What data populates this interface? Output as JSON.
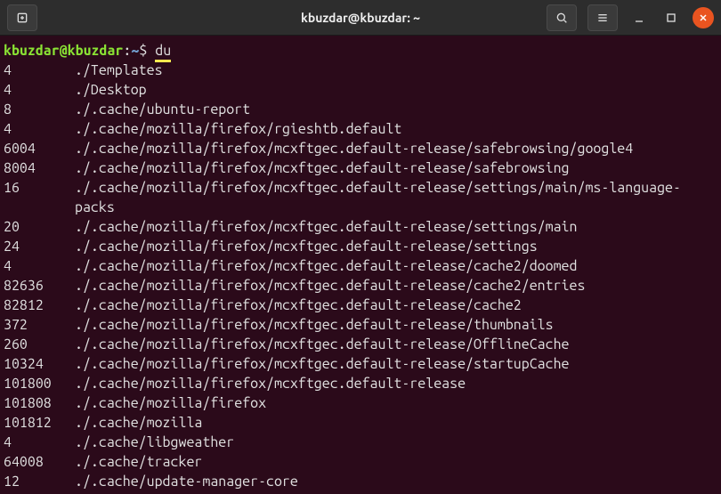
{
  "titlebar": {
    "title": "kbuzdar@kbuzdar: ~"
  },
  "prompt": {
    "user_host": "kbuzdar@kbuzdar",
    "colon": ":",
    "path": "~",
    "dollar": "$ ",
    "command": "du"
  },
  "output": [
    {
      "size": "4",
      "path": "./Templates"
    },
    {
      "size": "4",
      "path": "./Desktop"
    },
    {
      "size": "8",
      "path": "./.cache/ubuntu-report"
    },
    {
      "size": "4",
      "path": "./.cache/mozilla/firefox/rgieshtb.default"
    },
    {
      "size": "6004",
      "path": "./.cache/mozilla/firefox/mcxftgec.default-release/safebrowsing/google4"
    },
    {
      "size": "8004",
      "path": "./.cache/mozilla/firefox/mcxftgec.default-release/safebrowsing"
    },
    {
      "size": "16",
      "path": "./.cache/mozilla/firefox/mcxftgec.default-release/settings/main/ms-language-packs"
    },
    {
      "size": "20",
      "path": "./.cache/mozilla/firefox/mcxftgec.default-release/settings/main"
    },
    {
      "size": "24",
      "path": "./.cache/mozilla/firefox/mcxftgec.default-release/settings"
    },
    {
      "size": "4",
      "path": "./.cache/mozilla/firefox/mcxftgec.default-release/cache2/doomed"
    },
    {
      "size": "82636",
      "path": "./.cache/mozilla/firefox/mcxftgec.default-release/cache2/entries"
    },
    {
      "size": "82812",
      "path": "./.cache/mozilla/firefox/mcxftgec.default-release/cache2"
    },
    {
      "size": "372",
      "path": "./.cache/mozilla/firefox/mcxftgec.default-release/thumbnails"
    },
    {
      "size": "260",
      "path": "./.cache/mozilla/firefox/mcxftgec.default-release/OfflineCache"
    },
    {
      "size": "10324",
      "path": "./.cache/mozilla/firefox/mcxftgec.default-release/startupCache"
    },
    {
      "size": "101800",
      "path": "./.cache/mozilla/firefox/mcxftgec.default-release"
    },
    {
      "size": "101808",
      "path": "./.cache/mozilla/firefox"
    },
    {
      "size": "101812",
      "path": "./.cache/mozilla"
    },
    {
      "size": "4",
      "path": "./.cache/libgweather"
    },
    {
      "size": "64008",
      "path": "./.cache/tracker"
    },
    {
      "size": "12",
      "path": "./.cache/update-manager-core"
    }
  ]
}
